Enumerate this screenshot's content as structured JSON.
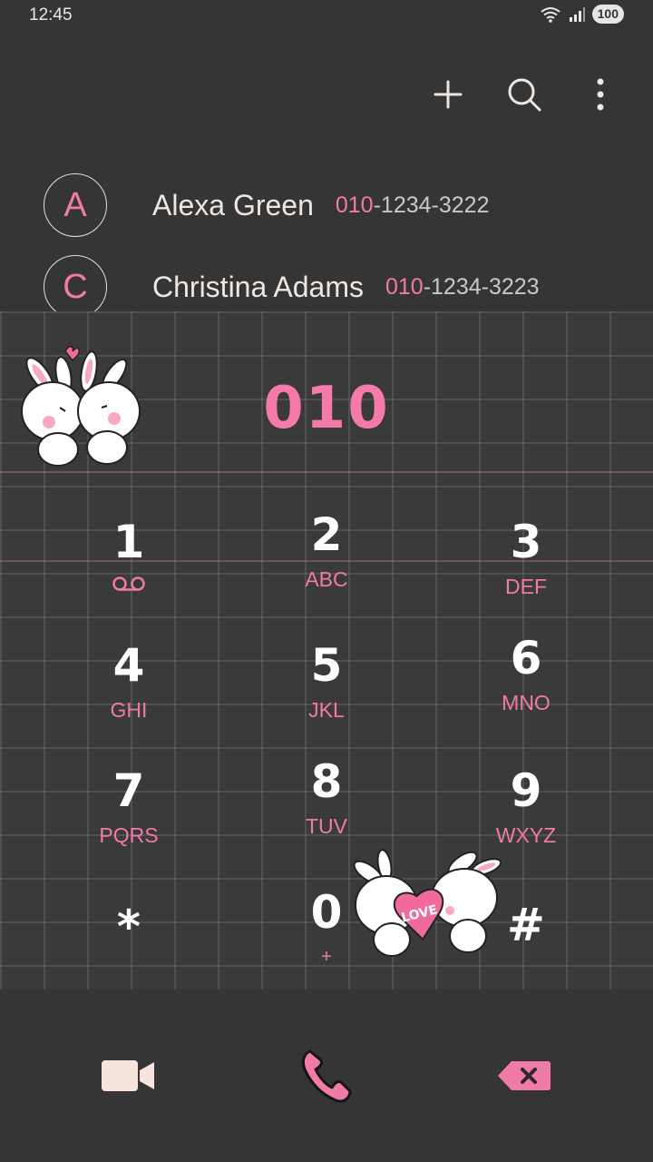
{
  "status_bar": {
    "time": "12:45",
    "battery": "100"
  },
  "toolbar": {
    "add_icon": "plus-icon",
    "search_icon": "search-icon",
    "more_icon": "more-vertical-icon"
  },
  "contacts": [
    {
      "initial": "A",
      "name": "Alexa Green",
      "number_match": "010",
      "number_rest": "-1234-3222"
    },
    {
      "initial": "C",
      "name": "Christina Adams",
      "number_match": "010",
      "number_rest": "-1234-3223"
    }
  ],
  "dialer": {
    "entered_number": "010",
    "keys": [
      {
        "digit": "1",
        "letters": ""
      },
      {
        "digit": "2",
        "letters": "ABC"
      },
      {
        "digit": "3",
        "letters": "DEF"
      },
      {
        "digit": "4",
        "letters": "GHI"
      },
      {
        "digit": "5",
        "letters": "JKL"
      },
      {
        "digit": "6",
        "letters": "MNO"
      },
      {
        "digit": "7",
        "letters": "PQRS"
      },
      {
        "digit": "8",
        "letters": "TUV"
      },
      {
        "digit": "9",
        "letters": "WXYZ"
      },
      {
        "digit": "*",
        "letters": ""
      },
      {
        "digit": "0",
        "letters": "+"
      },
      {
        "digit": "#",
        "letters": ""
      }
    ]
  },
  "sticker_text": "LOVE",
  "bottom_bar": {
    "video_icon": "video-call-icon",
    "call_icon": "phone-icon",
    "delete_icon": "backspace-icon"
  },
  "colors": {
    "accent": "#f07aa8",
    "background": "#353535",
    "text": "#f0e6e0"
  }
}
